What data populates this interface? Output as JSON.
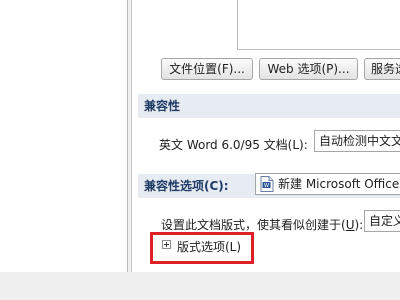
{
  "file_buttons": {
    "file_location": "文件位置(F)...",
    "web_options": "Web 选项(P)...",
    "services": "服务选"
  },
  "compat_section": {
    "title": "兼容性",
    "label": "英文 Word 6.0/95 文档(L):",
    "value": "自动检测中文文"
  },
  "compat_options_section": {
    "title": "兼容性选项(C):",
    "doc_name": "新建 Microsoft Office"
  },
  "layout_row": {
    "label": "设置此文档版式，使其看似创建于(U):",
    "value": "自定义"
  },
  "layout_options": {
    "label": "版式选项(L)"
  },
  "colors": {
    "section_bg": "#e7ebf2",
    "section_title": "#1f3b63",
    "highlight": "#dd1f26"
  }
}
